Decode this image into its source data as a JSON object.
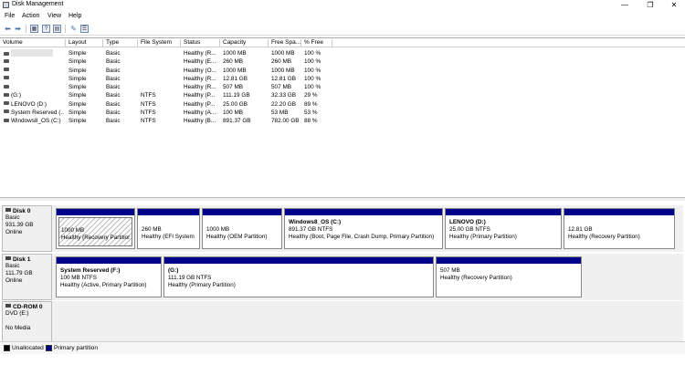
{
  "window": {
    "title": "Disk Management"
  },
  "window_controls": {
    "minimize": "—",
    "maximize": "❐",
    "close": "✕"
  },
  "menu": [
    "File",
    "Action",
    "View",
    "Help"
  ],
  "toolbar": {
    "icons": [
      "back-arrow-icon",
      "forward-arrow-icon",
      "disk-view-icon",
      "help-icon",
      "properties-icon",
      "connect-icon",
      "list-view-icon"
    ]
  },
  "volume_list": {
    "columns": [
      "Volume",
      "Layout",
      "Type",
      "File System",
      "Status",
      "Capacity",
      "Free Spa...",
      "% Free"
    ],
    "rows": [
      {
        "volume": "",
        "layout": "Simple",
        "type": "Basic",
        "fs": "",
        "status": "Healthy (R...",
        "capacity": "1000 MB",
        "free": "1000 MB",
        "pct": "100 %",
        "selected": true
      },
      {
        "volume": "",
        "layout": "Simple",
        "type": "Basic",
        "fs": "",
        "status": "Healthy (E...",
        "capacity": "260 MB",
        "free": "260 MB",
        "pct": "100 %"
      },
      {
        "volume": "",
        "layout": "Simple",
        "type": "Basic",
        "fs": "",
        "status": "Healthy (O...",
        "capacity": "1000 MB",
        "free": "1000 MB",
        "pct": "100 %"
      },
      {
        "volume": "",
        "layout": "Simple",
        "type": "Basic",
        "fs": "",
        "status": "Healthy (R...",
        "capacity": "12.81 GB",
        "free": "12.81 GB",
        "pct": "100 %"
      },
      {
        "volume": "",
        "layout": "Simple",
        "type": "Basic",
        "fs": "",
        "status": "Healthy (R...",
        "capacity": "507 MB",
        "free": "507 MB",
        "pct": "100 %"
      },
      {
        "volume": "(G:)",
        "layout": "Simple",
        "type": "Basic",
        "fs": "NTFS",
        "status": "Healthy (P...",
        "capacity": "111.19 GB",
        "free": "32.33 GB",
        "pct": "29 %"
      },
      {
        "volume": "LENOVO (D:)",
        "layout": "Simple",
        "type": "Basic",
        "fs": "NTFS",
        "status": "Healthy (P...",
        "capacity": "25.00 GB",
        "free": "22.20 GB",
        "pct": "89 %"
      },
      {
        "volume": "System Reserved (...",
        "layout": "Simple",
        "type": "Basic",
        "fs": "NTFS",
        "status": "Healthy (A...",
        "capacity": "100 MB",
        "free": "53 MB",
        "pct": "53 %"
      },
      {
        "volume": "Windows8_OS (C:)",
        "layout": "Simple",
        "type": "Basic",
        "fs": "NTFS",
        "status": "Healthy (B...",
        "capacity": "891.37 GB",
        "free": "782.00 GB",
        "pct": "88 %"
      }
    ]
  },
  "disks": [
    {
      "name": "Disk 0",
      "type": "Basic",
      "size": "931.39 GB",
      "state": "Online",
      "partitions": [
        {
          "title": "",
          "size": "1000 MB",
          "status": "Healthy (Recovery Partition)",
          "selected": true
        },
        {
          "title": "",
          "size": "260 MB",
          "status": "Healthy (EFI System P"
        },
        {
          "title": "",
          "size": "1000 MB",
          "status": "Healthy (OEM Partition)"
        },
        {
          "title": "Windows8_OS  (C:)",
          "size": "891.37 GB NTFS",
          "status": "Healthy (Boot, Page File, Crash Dump, Primary Partition)"
        },
        {
          "title": "LENOVO  (D:)",
          "size": "25.00 GB NTFS",
          "status": "Healthy (Primary Partition)"
        },
        {
          "title": "",
          "size": "12.81 GB",
          "status": "Healthy (Recovery Partition)"
        }
      ]
    },
    {
      "name": "Disk 1",
      "type": "Basic",
      "size": "111.79 GB",
      "state": "Online",
      "partitions": [
        {
          "title": "System Reserved  (F:)",
          "size": "100 MB NTFS",
          "status": "Healthy (Active, Primary Partition)"
        },
        {
          "title": "(G:)",
          "size": "111.19 GB NTFS",
          "status": "Healthy (Primary Partition)"
        },
        {
          "title": "",
          "size": "507 MB",
          "status": "Healthy (Recovery Partition)"
        }
      ]
    },
    {
      "name": "CD-ROM 0",
      "type": "DVD (E:)",
      "size": "",
      "state": "No Media",
      "partitions": []
    }
  ],
  "legend": [
    {
      "label": "Unallocated",
      "color": "#000000"
    },
    {
      "label": "Primary partition",
      "color": "#00008b"
    }
  ]
}
